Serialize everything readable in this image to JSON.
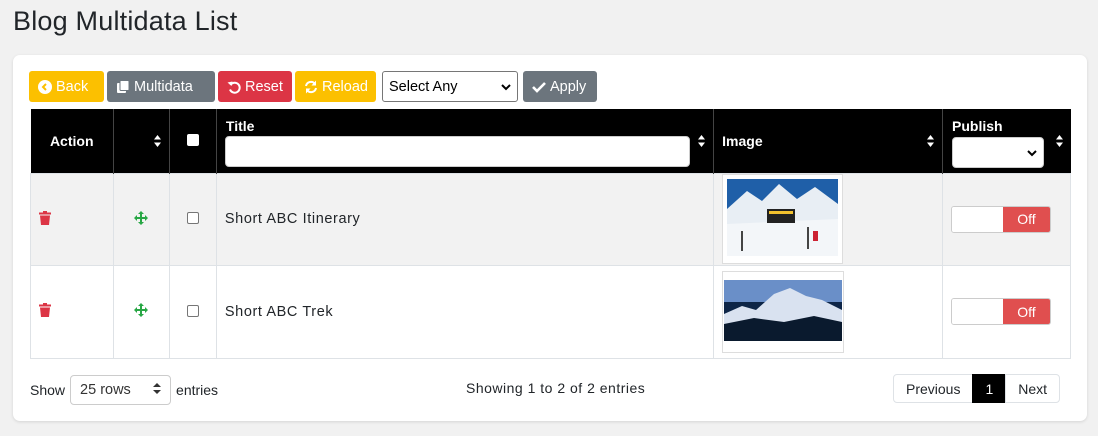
{
  "page_title": "Blog Multidata List",
  "toolbar": {
    "back_label": "Back",
    "multidata_label": "Multidata",
    "reset_label": "Reset",
    "reload_label": "Reload",
    "select_value": "Select Any",
    "apply_label": "Apply"
  },
  "table": {
    "headers": {
      "action": "Action",
      "title": "Title",
      "image": "Image",
      "publish": "Publish"
    },
    "rows": [
      {
        "title": "Short ABC Itinerary",
        "image": "annapurna-base-camp-sign-photo",
        "publish": "Off"
      },
      {
        "title": "Short ABC Trek",
        "image": "annapurna-mountain-range-photo",
        "publish": "Off"
      }
    ]
  },
  "footer": {
    "show_label": "Show",
    "rows_value": "25 rows",
    "entries_label": "entries",
    "info": "Showing 1 to 2 of 2 entries",
    "pagination": {
      "previous": "Previous",
      "current": "1",
      "next": "Next"
    }
  },
  "colors": {
    "warning": "#fcc000",
    "secondary": "#6c757d",
    "danger": "#dc3545",
    "header_bg": "#000000",
    "off_toggle": "#e04f4f",
    "icon_green": "#28a745"
  },
  "icons": [
    "arrow-left-circle-icon",
    "copy-icon",
    "undo-icon",
    "refresh-icon",
    "check-icon",
    "trash-icon",
    "move-icon",
    "sort-icon",
    "chevron-down-icon"
  ]
}
